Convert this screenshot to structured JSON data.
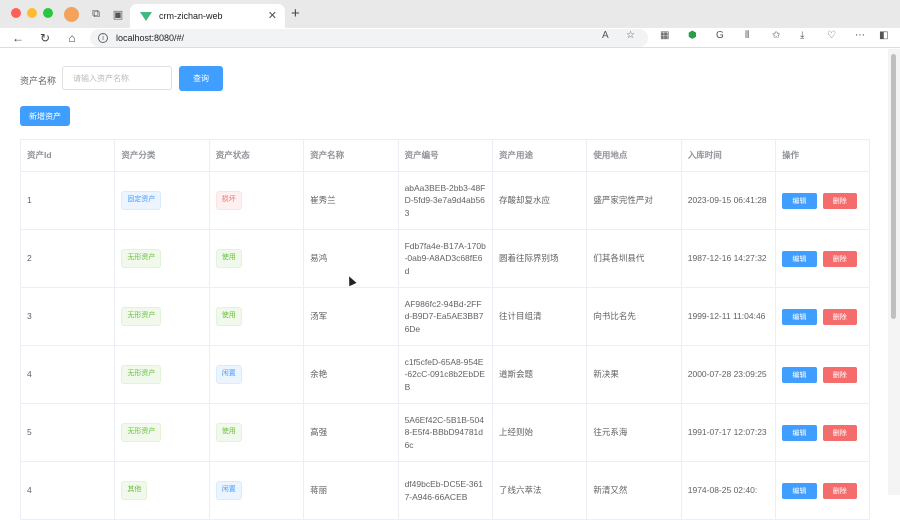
{
  "browser": {
    "tab_title": "crm-zichan-web",
    "url": "localhost:8080/#/",
    "traffic_colors": [
      "#ff5f57",
      "#febc2e",
      "#28c840"
    ]
  },
  "search": {
    "label": "资产名称",
    "placeholder": "请输入资产名称",
    "value": "",
    "query_button": "查询"
  },
  "toolbar": {
    "add_button": "新增资产"
  },
  "table": {
    "headers": [
      "资产Id",
      "资产分类",
      "资产状态",
      "资产名称",
      "资产编号",
      "资产用途",
      "使用地点",
      "入库时间",
      "操作"
    ],
    "edit_label": "编辑",
    "delete_label": "删除",
    "rows": [
      {
        "id": "1",
        "category": "固定资产",
        "category_tag": "blue",
        "status": "损坏",
        "status_tag": "red",
        "name": "崔秀兰",
        "code": "abAa3BEB-2bb3-48FD-5fd9-3e7a9d4ab563",
        "purpose": "存酸却复水应",
        "location": "盛严家完性严对",
        "time": "2023-09-15 06:41:28"
      },
      {
        "id": "2",
        "category": "无形资产",
        "category_tag": "green",
        "status": "使用",
        "status_tag": "green",
        "name": "易鸿",
        "code": "Fdb7fa4e-B17A-170b-0ab9-A8AD3c68fE6d",
        "purpose": "圆着往际界别场",
        "location": "们其各圳县代",
        "time": "1987-12-16 14:27:32"
      },
      {
        "id": "3",
        "category": "无形资产",
        "category_tag": "green",
        "status": "使用",
        "status_tag": "green",
        "name": "汤军",
        "code": "AF986fc2-94Bd-2FFd-B9D7-Ea5AE3BB76De",
        "purpose": "往计目组清",
        "location": "向书比名先",
        "time": "1999-12-11 11:04:46"
      },
      {
        "id": "4",
        "category": "无形资产",
        "category_tag": "green",
        "status": "闲置",
        "status_tag": "blue",
        "name": "余艳",
        "code": "c1f5cfeD-65A8-954E-62cC-091c8b2EbDEB",
        "purpose": "道斯会题",
        "location": "新决果",
        "time": "2000-07-28 23:09:25"
      },
      {
        "id": "5",
        "category": "无形资产",
        "category_tag": "green",
        "status": "使用",
        "status_tag": "green",
        "name": "高强",
        "code": "5A6Ef42C-5B1B-5048-E5f4-BBbD94781d6c",
        "purpose": "上经则始",
        "location": "往元系海",
        "time": "1991-07-17 12:07:23"
      },
      {
        "id": "4",
        "category": "其他",
        "category_tag": "green",
        "status": "闲置",
        "status_tag": "blue",
        "name": "蒋丽",
        "code": "df49bcEb-DC5E-3617-A946-66ACEB",
        "purpose": "了线六萃法",
        "location": "新清又然",
        "time": "1974-08-25 02:40:"
      }
    ]
  }
}
